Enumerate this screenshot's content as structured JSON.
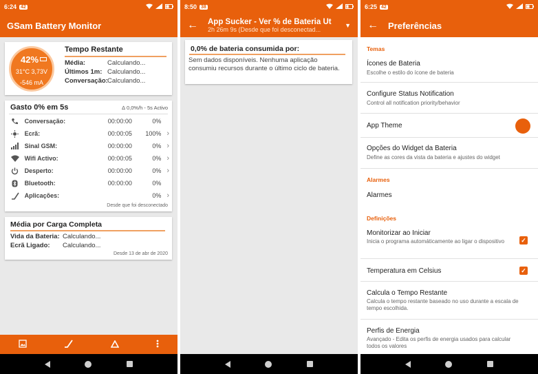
{
  "colors": {
    "accent": "#e8600c",
    "navbar": "#000000",
    "background": "#e9e9e9"
  },
  "panel1": {
    "status": {
      "time": "6:24",
      "badge": "42"
    },
    "app_title": "GSam Battery Monitor",
    "gauge": {
      "percent": "42%",
      "temp_volt": "31°C  3,73V",
      "current": "-546 mA"
    },
    "remaining": {
      "title": "Tempo Restante",
      "rows": [
        {
          "k": "Média:",
          "v": "Calculando..."
        },
        {
          "k": "Últimos 1m:",
          "v": "Calculando..."
        },
        {
          "k": "Conversação:",
          "v": "Calculando..."
        }
      ]
    },
    "usage": {
      "title": "Gasto 0% em 5s",
      "rate": "∆ 0,0%/h - 5s Activo",
      "rows": [
        {
          "icon": "phone-icon",
          "label": "Conversação:",
          "time": "00:00:00",
          "pct": "0%",
          "chevron": ""
        },
        {
          "icon": "screen-icon",
          "label": "Ecrã:",
          "time": "00:00:05",
          "pct": "100%",
          "chevron": "›"
        },
        {
          "icon": "signal-icon",
          "label": "Sinal GSM:",
          "time": "00:00:00",
          "pct": "0%",
          "chevron": "›"
        },
        {
          "icon": "wifi-icon",
          "label": "Wifi Activo:",
          "time": "00:00:05",
          "pct": "0%",
          "chevron": "›"
        },
        {
          "icon": "power-icon",
          "label": "Desperto:",
          "time": "00:00:00",
          "pct": "0%",
          "chevron": "›"
        },
        {
          "icon": "bluetooth-icon",
          "label": "Bluetooth:",
          "time": "00:00:00",
          "pct": "0%",
          "chevron": ""
        },
        {
          "icon": "apps-icon",
          "label": "Aplicações:",
          "time": "",
          "pct": "0%",
          "chevron": "›"
        }
      ],
      "footer": "Desde que foi desconectado"
    },
    "average": {
      "title": "Média por Carga Completa",
      "rows": [
        {
          "k": "Vida da Bateria:",
          "v": "Calculando..."
        },
        {
          "k": "Ecrã Ligado:",
          "v": "Calculando..."
        }
      ],
      "footer": "Desde 13 de abr de 2020"
    }
  },
  "panel2": {
    "status": {
      "time": "8:50",
      "badge": "38"
    },
    "title": "App Sucker - Ver % de Bateria Utili...",
    "subtitle": "2h 26m 9s (Desde que foi desconectad...",
    "card_title": "0,0% de bateria consumida por:",
    "card_body": "Sem dados disponíveis. Nenhuma aplicação consumiu recursos durante o último ciclo de bateria."
  },
  "panel3": {
    "status": {
      "time": "6:25",
      "badge": "42"
    },
    "title": "Preferências",
    "categories": {
      "themes": "Temas",
      "alarms": "Alarmes",
      "definitions": "Definições"
    },
    "items": {
      "battery_icons": {
        "title": "Ícones de Bateria",
        "summary": "Escolhe o estilo do ícone de bateria"
      },
      "status_notification": {
        "title": "Configure Status Notification",
        "summary": "Control all notification priority/behavior"
      },
      "app_theme": {
        "title": "App Theme"
      },
      "widget_options": {
        "title": "Opções do Widget da Bateria",
        "summary": "Define as cores da vista da bateria e ajustes do widget"
      },
      "alarms": {
        "title": "Alarmes"
      },
      "monitor_on_start": {
        "title": "Monitorizar ao Iniciar",
        "summary": "Inicia o programa automáticamente ao ligar o dispositivo"
      },
      "celsius": {
        "title": "Temperatura em Celsius"
      },
      "calc_remaining": {
        "title": "Calcula o Tempo Restante",
        "summary": "Calcula o tempo restante baseado no uso durante a escala de tempo escolhida."
      },
      "energy_profiles": {
        "title": "Perfis de Energia",
        "summary": "Avançado - Edita os perfis de energia usados para calcular todos os valores"
      }
    }
  }
}
